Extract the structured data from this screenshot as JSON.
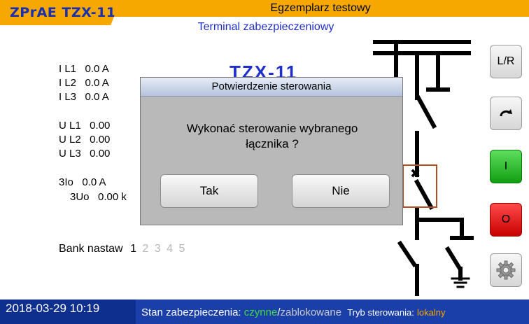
{
  "header": {
    "brand": "ZPrAE TZX-11",
    "title": "Egzemplarz testowy",
    "subtitle": "Terminal zabezpieczeniowy",
    "device_name": "TZX-11"
  },
  "measurements": {
    "il1": "I L1   0.0 A",
    "il2": "I L2   0.0 A",
    "il3": "I L3   0.0 A",
    "ul1": "U L1   0.00",
    "ul2": "U L2   0.00",
    "ul3": "U L3   0.00",
    "i0": "3Io   0.0 A",
    "u0": "3Uo   0.00 k"
  },
  "bank": {
    "label": "Bank nastaw",
    "active": "1",
    "others": [
      "2",
      "3",
      "4",
      "5"
    ]
  },
  "side_buttons": {
    "lr": "L/R",
    "rotate_icon": "rotate-arrow-icon",
    "close": "I",
    "open": "O",
    "settings_icon": "gear-icon"
  },
  "footer": {
    "datetime": "2018-03-29 10:19",
    "status_label": "Stan zabezpieczenia:",
    "status_active": "czynne",
    "separator": "/",
    "status_blocked": "zablokowane",
    "mode_label": "Tryb sterowania:",
    "mode_value": "lokalny"
  },
  "dialog": {
    "title": "Potwierdzenie sterowania",
    "message_line1": "Wykonać sterowanie wybranego",
    "message_line2": "łącznika ?",
    "yes": "Tak",
    "no": "Nie"
  },
  "colors": {
    "accent": "#f6a800",
    "brand_text": "#1a2fb0",
    "footer": "#1a3fa8",
    "status_ok": "#43d843",
    "close_button": "#10a010",
    "open_button": "#c80000"
  }
}
